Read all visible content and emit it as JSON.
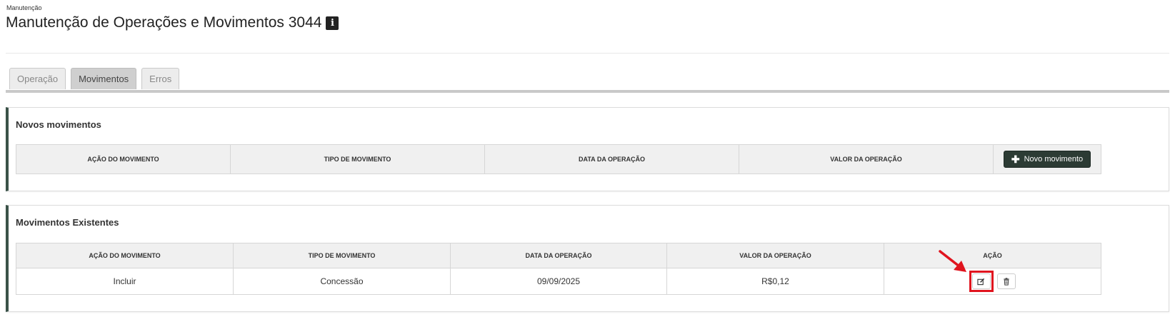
{
  "breadcrumb": "Manutenção",
  "page_title": "Manutenção de Operações e Movimentos 3044",
  "tabs": [
    {
      "label": "Operação",
      "active": false
    },
    {
      "label": "Movimentos",
      "active": true
    },
    {
      "label": "Erros",
      "active": false
    }
  ],
  "novos": {
    "title": "Novos movimentos",
    "columns": [
      "AÇÃO DO MOVIMENTO",
      "TIPO DE MOVIMENTO",
      "DATA DA OPERAÇÃO",
      "VALOR DA OPERAÇÃO"
    ],
    "button_label": "Novo movimento",
    "button_icon": "plus-icon"
  },
  "existentes": {
    "title": "Movimentos Existentes",
    "columns": [
      "AÇÃO DO MOVIMENTO",
      "TIPO DE MOVIMENTO",
      "DATA DA OPERAÇÃO",
      "VALOR DA OPERAÇÃO",
      "AÇÃO"
    ],
    "rows": [
      {
        "acao": "Incluir",
        "tipo": "Concessão",
        "data": "09/09/2025",
        "valor": "R$0,12"
      }
    ],
    "row_actions": [
      "edit-icon",
      "trash-icon"
    ]
  },
  "colors": {
    "panel_accent": "#3a5248",
    "primary_button": "#2c3b34",
    "highlight": "#e0141e"
  }
}
